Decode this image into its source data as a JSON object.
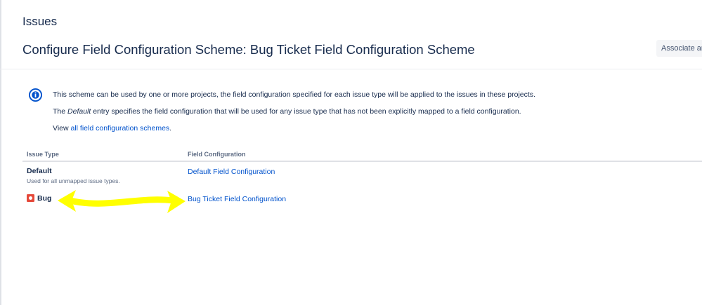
{
  "header": {
    "section": "Issues",
    "title": "Configure Field Configuration Scheme: Bug Ticket Field Configuration Scheme",
    "associate_button": "Associate an"
  },
  "info": {
    "p1": "This scheme can be used by one or more projects, the field configuration specified for each issue type will be applied to the issues in these projects.",
    "p2_before": "The ",
    "p2_em": "Default",
    "p2_after": " entry specifies the field configuration that will be used for any issue type that has not been explicitly mapped to a field configuration.",
    "p3_before": "View ",
    "p3_link": "all field configuration schemes",
    "p3_after": "."
  },
  "table": {
    "headers": [
      "Issue Type",
      "Field Configuration"
    ],
    "rows": [
      {
        "issue_type": "Default",
        "description": "Used for all unmapped issue types.",
        "field_configuration": "Default Field Configuration"
      },
      {
        "issue_type": "Bug",
        "field_configuration": "Bug Ticket Field Configuration",
        "icon": "bug-icon"
      }
    ]
  },
  "colors": {
    "link": "#0052cc",
    "text": "#172b4d",
    "bug": "#e5493a",
    "info": "#0052cc",
    "annotation": "#ffff00"
  }
}
